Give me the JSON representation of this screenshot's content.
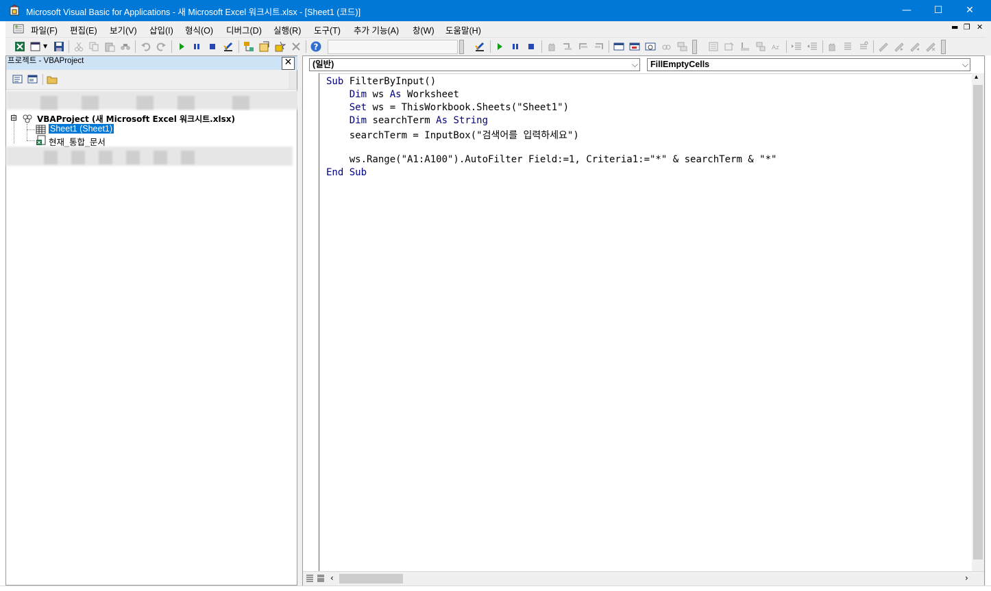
{
  "window": {
    "title": "Microsoft Visual Basic for Applications - 새 Microsoft Excel 워크시트.xlsx - [Sheet1 (코드)]",
    "minimize": "—",
    "maximize": "☐",
    "close": "✕"
  },
  "menu": {
    "items": [
      "파일(F)",
      "편집(E)",
      "보기(V)",
      "삽입(I)",
      "형식(O)",
      "디버그(D)",
      "실행(R)",
      "도구(T)",
      "추가 기능(A)",
      "창(W)",
      "도움말(H)"
    ],
    "mdi_min": "▬",
    "mdi_restore": "❐",
    "mdi_close": "✕"
  },
  "toolbar": {
    "help_glyph": "?"
  },
  "project_panel": {
    "title": "프로젝트 - VBAProject",
    "close": "✕",
    "tree": {
      "project_expand": "⊟",
      "project_label": "VBAProject (새 Microsoft Excel 워크시트.xlsx)",
      "sheet_label": "Sheet1 (Sheet1)",
      "workbook_label": "현재_통합_문서"
    }
  },
  "code_window": {
    "object_combo": "(일반)",
    "procedure_combo": "FillEmptyCells",
    "code": [
      [
        {
          "t": "Sub ",
          "k": true
        },
        {
          "t": "FilterByInput()",
          "k": false
        }
      ],
      [
        {
          "t": "    ",
          "k": false
        },
        {
          "t": "Dim",
          "k": true
        },
        {
          "t": " ws ",
          "k": false
        },
        {
          "t": "As",
          "k": true
        },
        {
          "t": " Worksheet",
          "k": false
        }
      ],
      [
        {
          "t": "    ",
          "k": false
        },
        {
          "t": "Set",
          "k": true
        },
        {
          "t": " ws = ThisWorkbook.Sheets(\"Sheet1\")",
          "k": false
        }
      ],
      [
        {
          "t": "    ",
          "k": false
        },
        {
          "t": "Dim",
          "k": true
        },
        {
          "t": " searchTerm ",
          "k": false
        },
        {
          "t": "As String",
          "k": true
        }
      ],
      [
        {
          "t": "    searchTerm = InputBox(\"검색어를 입력하세요\")",
          "k": false
        }
      ],
      [
        {
          "t": "",
          "k": false
        }
      ],
      [
        {
          "t": "    ws.Range(\"A1:A100\").AutoFilter Field:=1, Criteria1:=\"*\" & searchTerm & \"*\"",
          "k": false
        }
      ],
      [
        {
          "t": "End Sub",
          "k": true
        }
      ]
    ]
  },
  "colors": {
    "titlebar": "#0078d7",
    "keyword": "#00007f",
    "selection": "#0078d7"
  }
}
